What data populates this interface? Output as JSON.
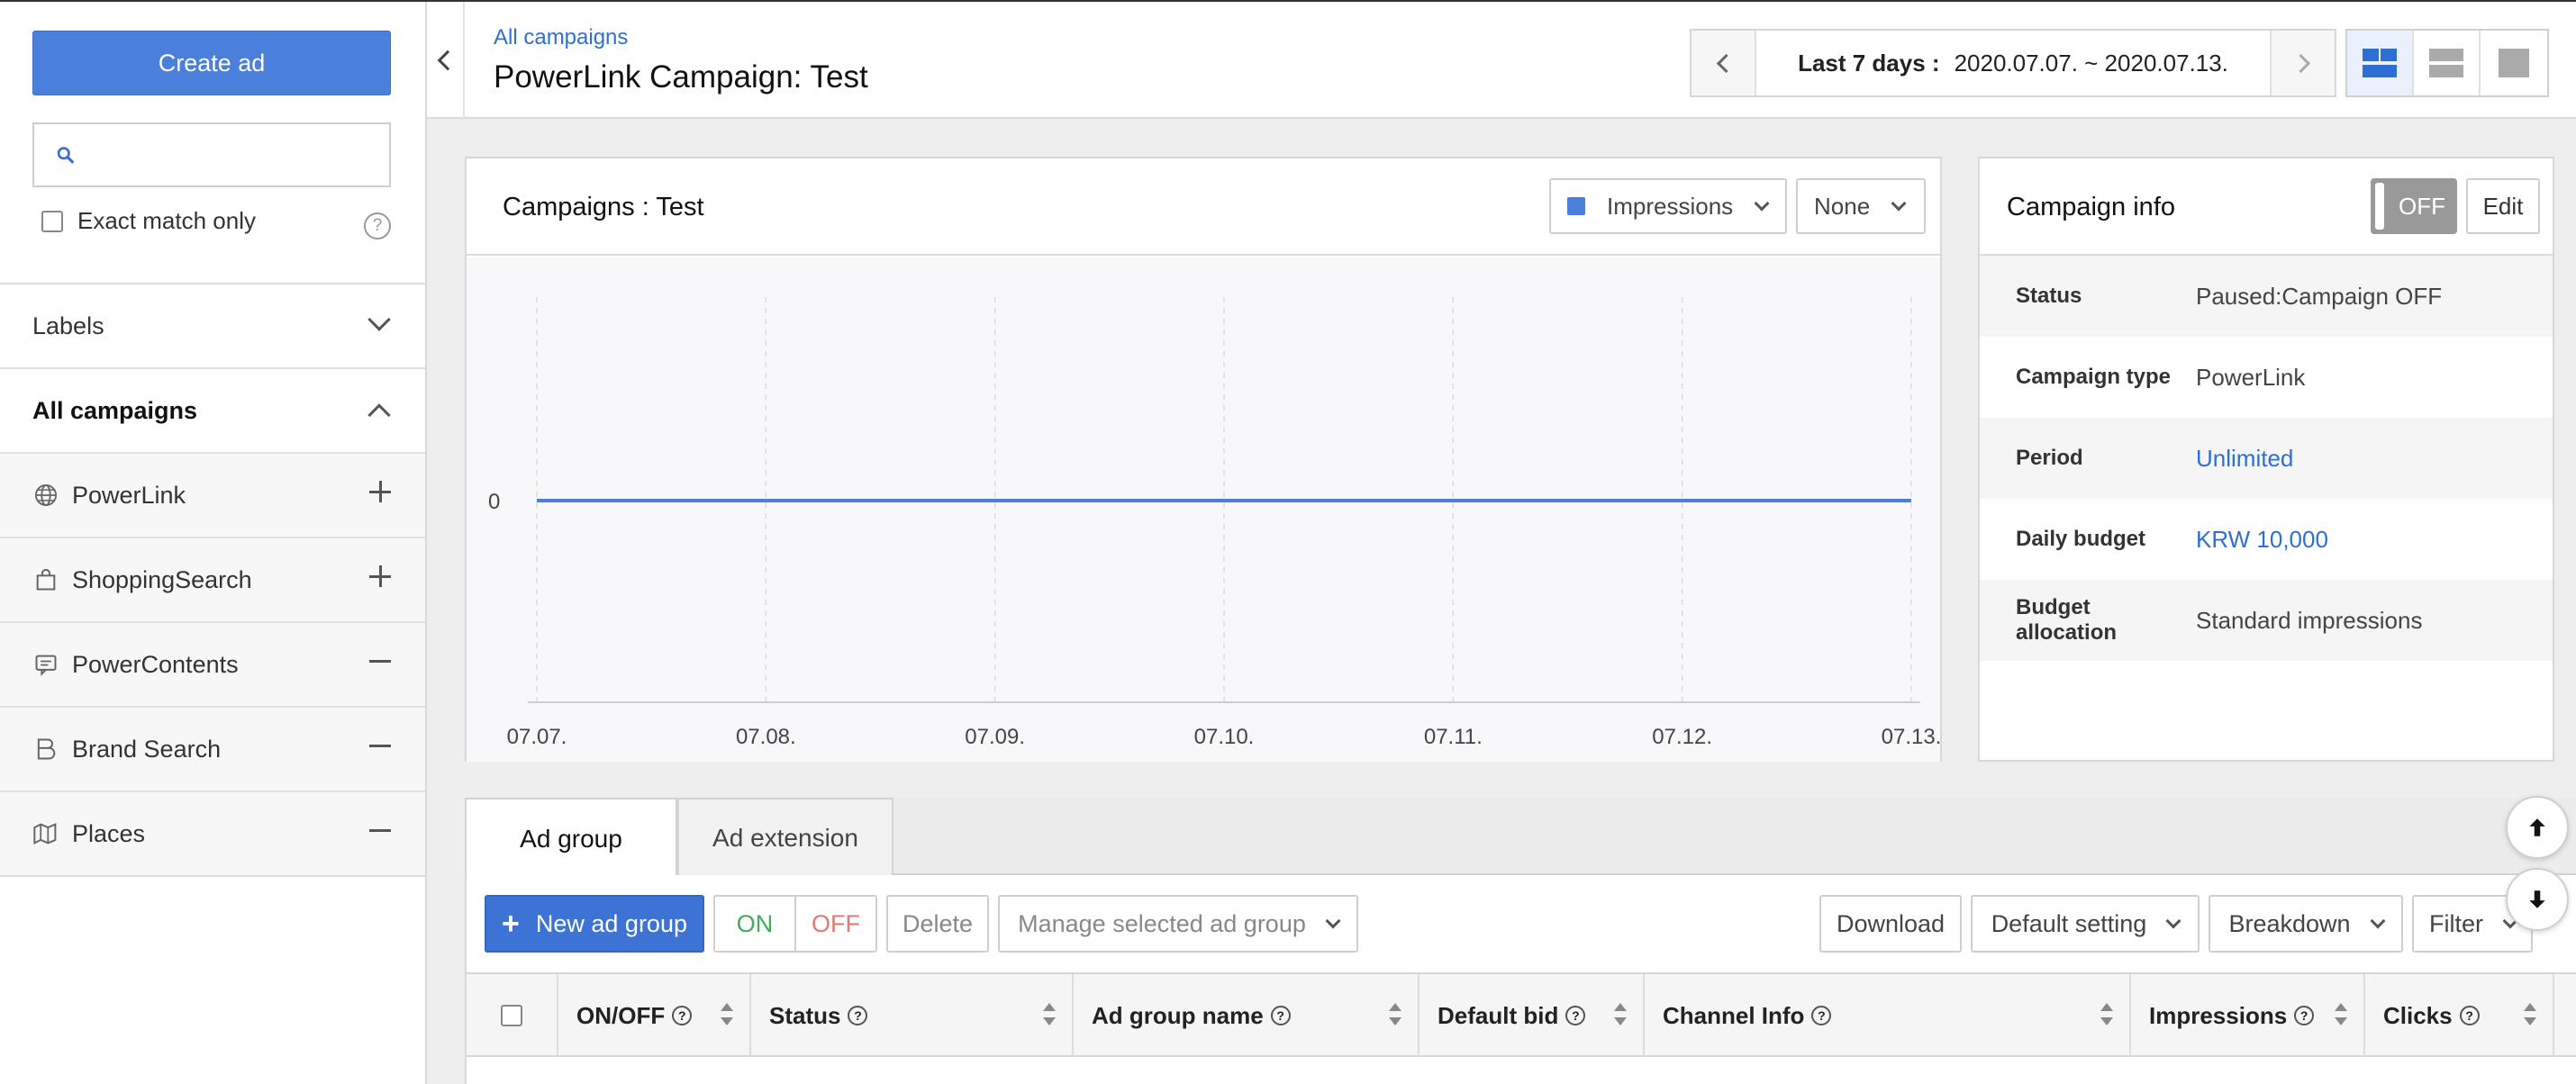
{
  "sidebar": {
    "create_label": "Create ad",
    "search_placeholder": "",
    "exact_match_label": "Exact match only",
    "help_glyph": "?",
    "labels_section": "Labels",
    "all_campaigns": "All campaigns",
    "campaign_types": [
      {
        "label": "PowerLink",
        "icon": "globe-icon",
        "action": "plus"
      },
      {
        "label": "ShoppingSearch",
        "icon": "shopping-bag-icon",
        "action": "plus"
      },
      {
        "label": "PowerContents",
        "icon": "content-icon",
        "action": "minus"
      },
      {
        "label": "Brand Search",
        "icon": "brand-icon",
        "action": "minus"
      },
      {
        "label": "Places",
        "icon": "map-icon",
        "action": "minus"
      }
    ]
  },
  "header": {
    "breadcrumb": "All campaigns",
    "title": "PowerLink Campaign: Test",
    "date_prefix": "Last 7 days :",
    "date_range": "2020.07.07.  ~  2020.07.13."
  },
  "chart_card": {
    "title": "Campaigns : Test",
    "metric_primary": "Impressions",
    "metric_secondary": "None",
    "series_color": "#4a7fdb"
  },
  "chart_data": {
    "type": "line",
    "x": [
      "07.07.",
      "07.08.",
      "07.09.",
      "07.10.",
      "07.11.",
      "07.12.",
      "07.13."
    ],
    "series": [
      {
        "name": "Impressions",
        "values": [
          0,
          0,
          0,
          0,
          0,
          0,
          0
        ]
      }
    ],
    "y_ticks": [
      "0"
    ],
    "grid": "vertical-dashed"
  },
  "campaign_info": {
    "title": "Campaign info",
    "toggle_label": "OFF",
    "edit_label": "Edit",
    "rows": [
      {
        "key": "Status",
        "value": "Paused:Campaign OFF",
        "link": false
      },
      {
        "key": "Campaign type",
        "value": "PowerLink",
        "link": false
      },
      {
        "key": "Period",
        "value": "Unlimited",
        "link": true
      },
      {
        "key": "Daily budget",
        "value": "KRW 10,000",
        "link": true
      },
      {
        "key": "Budget allocation",
        "value": "Standard impressions",
        "link": false
      }
    ]
  },
  "tabs": [
    "Ad group",
    "Ad extension"
  ],
  "toolbar": {
    "new_ad_group": "New ad group",
    "on": "ON",
    "off": "OFF",
    "delete": "Delete",
    "manage": "Manage selected ad group",
    "download": "Download",
    "default_setting": "Default setting",
    "breakdown": "Breakdown",
    "filter": "Filter"
  },
  "table": {
    "columns": [
      "ON/OFF",
      "Status",
      "Ad group name",
      "Default bid",
      "Channel Info",
      "Impressions",
      "Clicks"
    ]
  }
}
